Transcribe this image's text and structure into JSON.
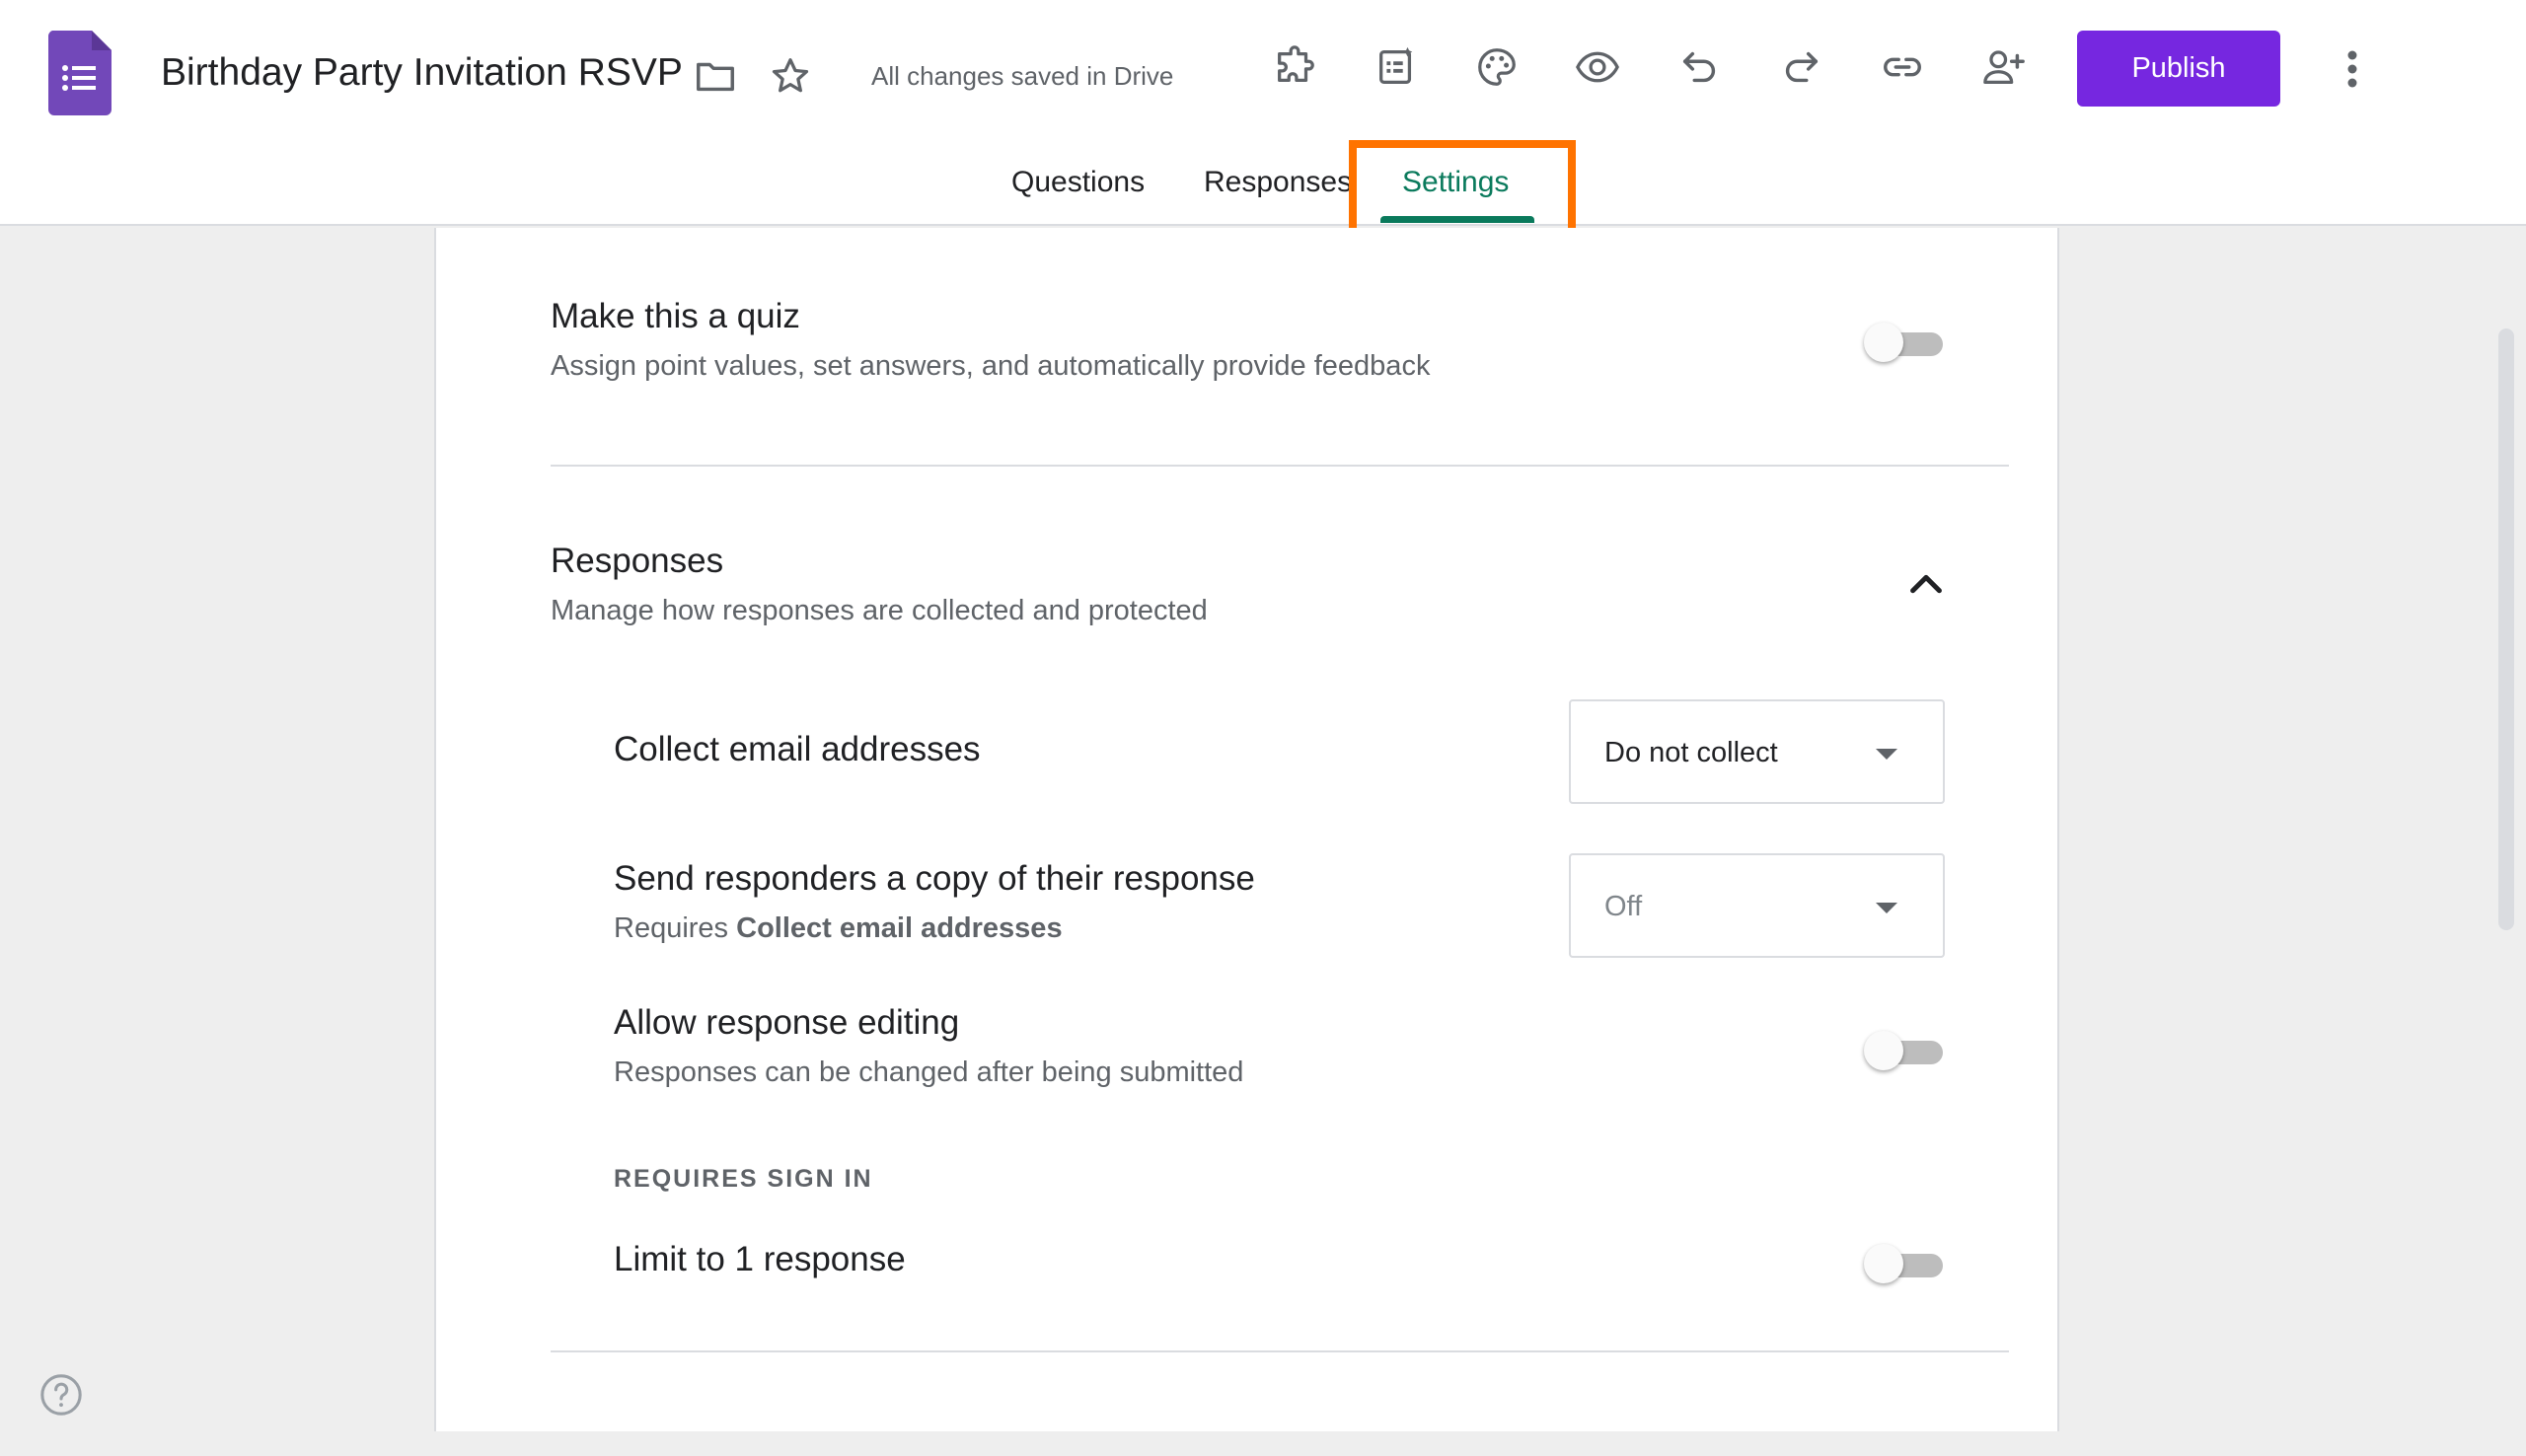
{
  "header": {
    "title": "Birthday Party Invitation RSVP",
    "saved_status": "All changes saved in Drive",
    "publish_label": "Publish",
    "icons": [
      "folder-icon",
      "star-icon",
      "addons-icon",
      "ai-form-icon",
      "palette-icon",
      "preview-icon",
      "undo-icon",
      "redo-icon",
      "link-icon",
      "add-collaborator-icon",
      "more-vert-icon"
    ]
  },
  "tabs": [
    {
      "label": "Questions",
      "active": false
    },
    {
      "label": "Responses",
      "active": false
    },
    {
      "label": "Settings",
      "active": true
    }
  ],
  "settings": {
    "quiz": {
      "title": "Make this a quiz",
      "subtitle": "Assign point values, set answers, and automatically provide feedback",
      "enabled": false
    },
    "responses": {
      "title": "Responses",
      "subtitle": "Manage how responses are collected and protected",
      "expanded": true,
      "collect_email": {
        "label": "Collect email addresses",
        "value": "Do not collect"
      },
      "send_copy": {
        "label": "Send responders a copy of their response",
        "requires_prefix": "Requires",
        "requires_bold": "Collect email addresses",
        "value": "Off"
      },
      "allow_editing": {
        "label": "Allow response editing",
        "subtitle": "Responses can be changed after being submitted",
        "enabled": false
      },
      "requires_sign_in_label": "REQUIRES SIGN IN",
      "limit_one": {
        "label": "Limit to 1 response",
        "enabled": false
      }
    }
  },
  "colors": {
    "brand": "#7627e0",
    "active_tab": "#0a7a5c",
    "highlight": "#ff7300"
  }
}
